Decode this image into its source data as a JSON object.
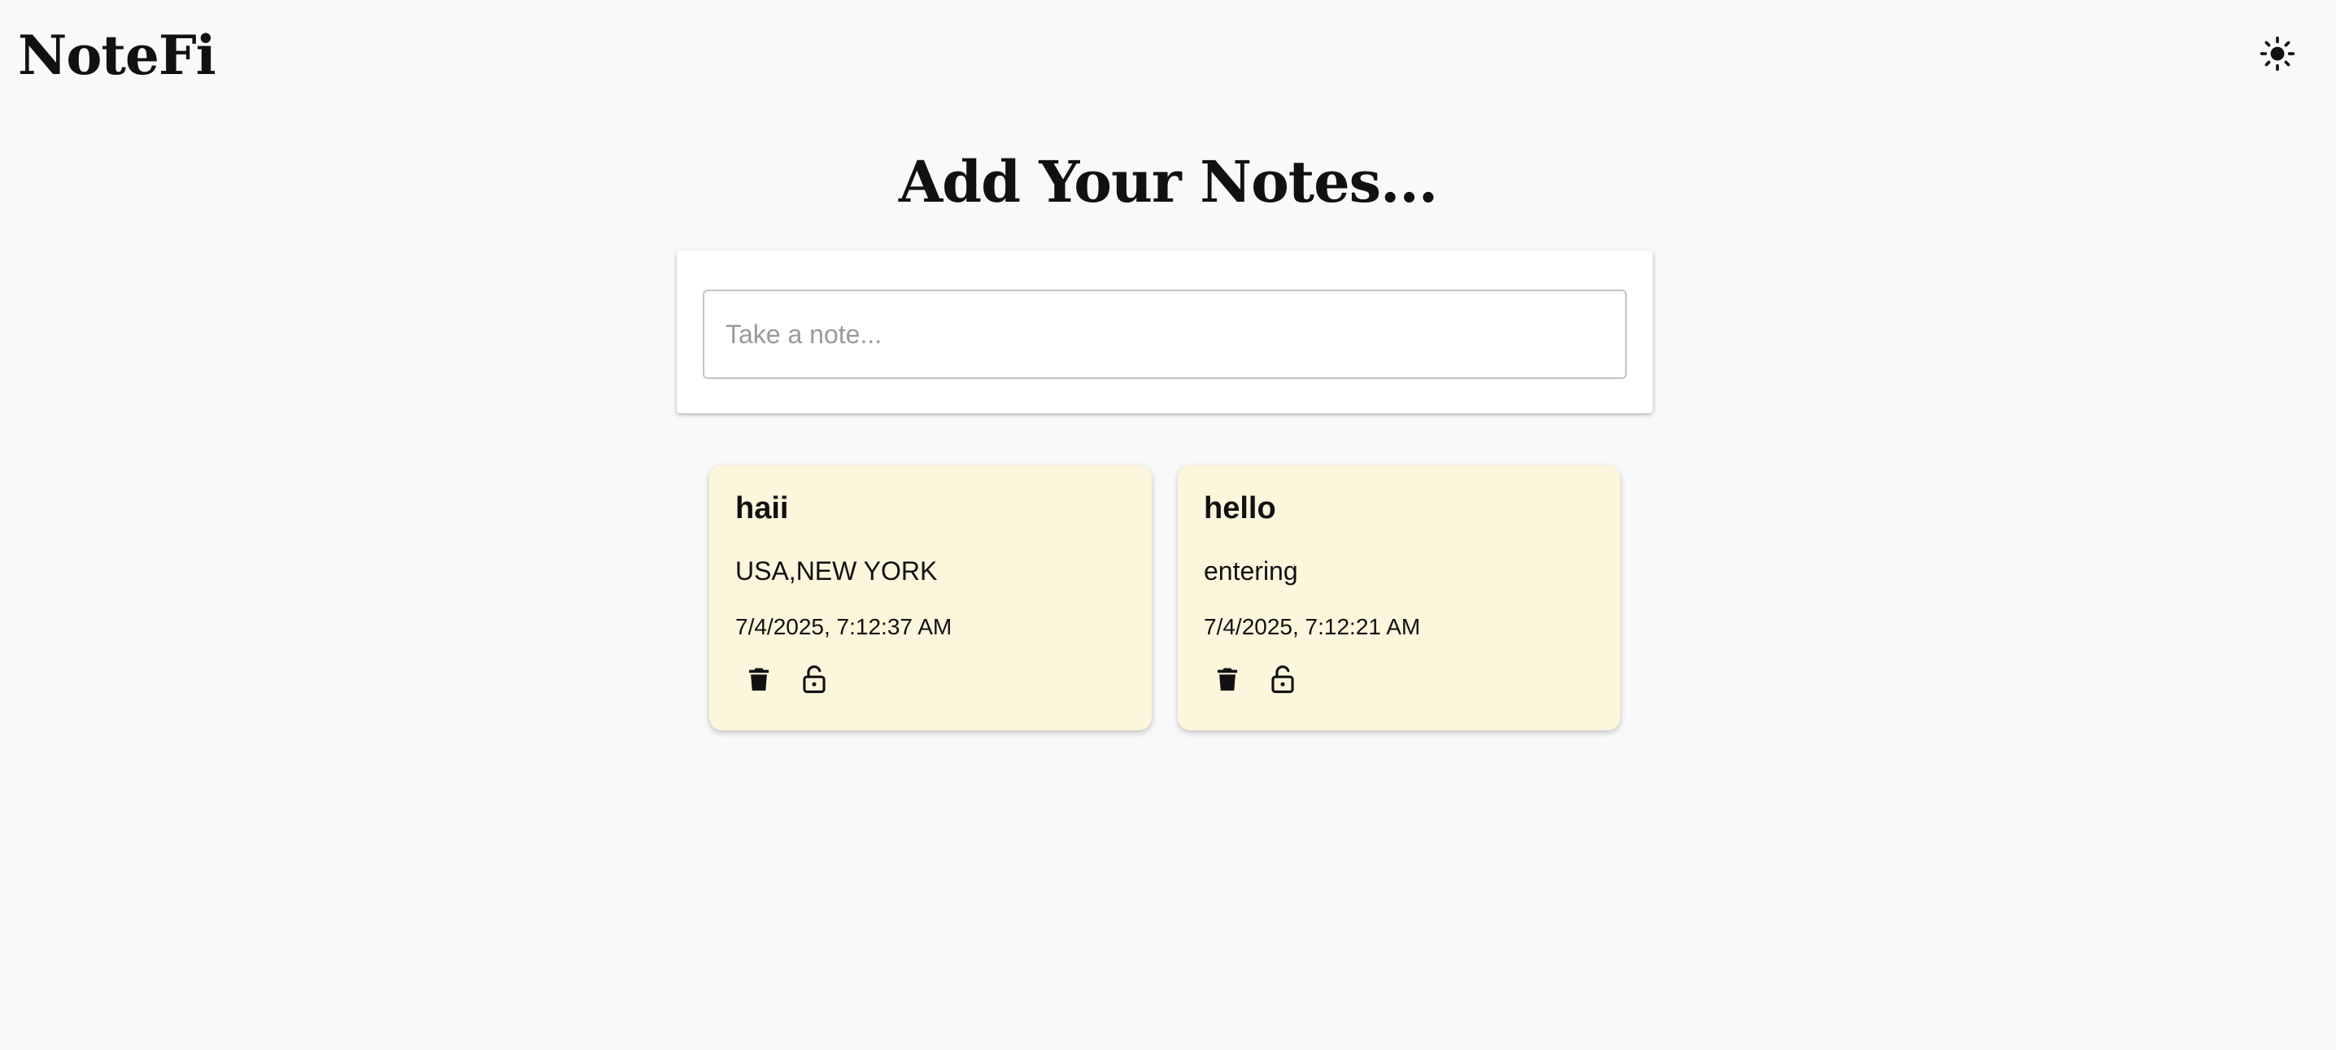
{
  "app": {
    "title": "NoteFi",
    "theme_icon": "sun-icon"
  },
  "main": {
    "heading": "Add Your Notes...",
    "input": {
      "placeholder": "Take a note...",
      "value": ""
    }
  },
  "notes": [
    {
      "title": "haii",
      "body": "USA,NEW YORK",
      "date": "7/4/2025, 7:12:37 AM",
      "actions": [
        "trash-icon",
        "unlock-icon"
      ]
    },
    {
      "title": "hello",
      "body": "entering",
      "date": "7/4/2025, 7:12:21 AM",
      "actions": [
        "trash-icon",
        "unlock-icon"
      ]
    }
  ],
  "colors": {
    "background": "#f9f9f9",
    "card": "#fcf6dd",
    "text": "#111111"
  }
}
